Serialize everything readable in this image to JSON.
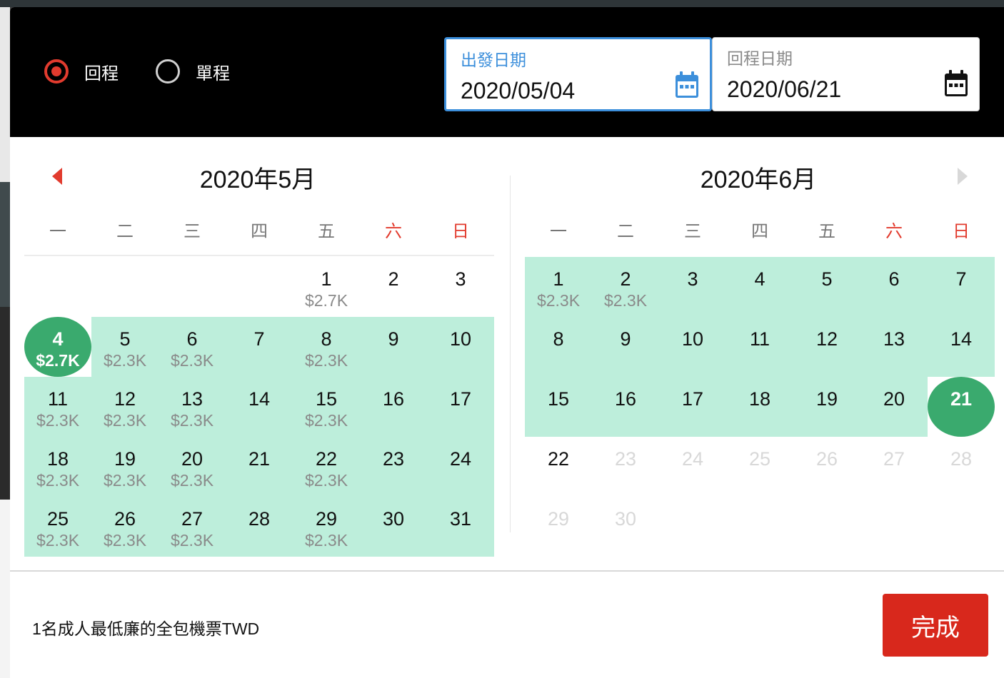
{
  "trip_type": {
    "options": [
      {
        "label": "回程",
        "checked": true
      },
      {
        "label": "單程",
        "checked": false
      }
    ]
  },
  "departure": {
    "label": "出發日期",
    "value": "2020/05/04",
    "icon": "calendar-icon",
    "icon_color": "#3c8fdb"
  },
  "return": {
    "label": "回程日期",
    "value": "2020/06/21",
    "icon": "calendar-icon",
    "icon_color": "#111111"
  },
  "weekdays": [
    "一",
    "二",
    "三",
    "四",
    "五",
    "六",
    "日"
  ],
  "colors": {
    "accent": "#e23b2e",
    "range": "#bdeedb",
    "selected": "#3aaa6e",
    "active_border": "#3c8fdb",
    "done_button": "#d8281c"
  },
  "months": [
    {
      "title": "2020年5月",
      "nav": "prev-month-arrow",
      "start_weekday_index": 4,
      "days": [
        {
          "d": "1",
          "p": "$2.7K",
          "s": "normal"
        },
        {
          "d": "2",
          "p": "",
          "s": "normal"
        },
        {
          "d": "3",
          "p": "",
          "s": "normal"
        },
        {
          "d": "4",
          "p": "$2.7K",
          "s": "selected"
        },
        {
          "d": "5",
          "p": "$2.3K",
          "s": "range"
        },
        {
          "d": "6",
          "p": "$2.3K",
          "s": "range"
        },
        {
          "d": "7",
          "p": "",
          "s": "range"
        },
        {
          "d": "8",
          "p": "$2.3K",
          "s": "range"
        },
        {
          "d": "9",
          "p": "",
          "s": "range"
        },
        {
          "d": "10",
          "p": "",
          "s": "range"
        },
        {
          "d": "11",
          "p": "$2.3K",
          "s": "range"
        },
        {
          "d": "12",
          "p": "$2.3K",
          "s": "range"
        },
        {
          "d": "13",
          "p": "$2.3K",
          "s": "range"
        },
        {
          "d": "14",
          "p": "",
          "s": "range"
        },
        {
          "d": "15",
          "p": "$2.3K",
          "s": "range"
        },
        {
          "d": "16",
          "p": "",
          "s": "range"
        },
        {
          "d": "17",
          "p": "",
          "s": "range"
        },
        {
          "d": "18",
          "p": "$2.3K",
          "s": "range"
        },
        {
          "d": "19",
          "p": "$2.3K",
          "s": "range"
        },
        {
          "d": "20",
          "p": "$2.3K",
          "s": "range"
        },
        {
          "d": "21",
          "p": "",
          "s": "range"
        },
        {
          "d": "22",
          "p": "$2.3K",
          "s": "range"
        },
        {
          "d": "23",
          "p": "",
          "s": "range"
        },
        {
          "d": "24",
          "p": "",
          "s": "range"
        },
        {
          "d": "25",
          "p": "$2.3K",
          "s": "range"
        },
        {
          "d": "26",
          "p": "$2.3K",
          "s": "range"
        },
        {
          "d": "27",
          "p": "$2.3K",
          "s": "range"
        },
        {
          "d": "28",
          "p": "",
          "s": "range"
        },
        {
          "d": "29",
          "p": "$2.3K",
          "s": "range"
        },
        {
          "d": "30",
          "p": "",
          "s": "range"
        },
        {
          "d": "31",
          "p": "",
          "s": "range"
        }
      ]
    },
    {
      "title": "2020年6月",
      "nav": "next-month-arrow",
      "start_weekday_index": 0,
      "days": [
        {
          "d": "1",
          "p": "$2.3K",
          "s": "range"
        },
        {
          "d": "2",
          "p": "$2.3K",
          "s": "range"
        },
        {
          "d": "3",
          "p": "",
          "s": "range"
        },
        {
          "d": "4",
          "p": "",
          "s": "range"
        },
        {
          "d": "5",
          "p": "",
          "s": "range"
        },
        {
          "d": "6",
          "p": "",
          "s": "range"
        },
        {
          "d": "7",
          "p": "",
          "s": "range"
        },
        {
          "d": "8",
          "p": "",
          "s": "range"
        },
        {
          "d": "9",
          "p": "",
          "s": "range"
        },
        {
          "d": "10",
          "p": "",
          "s": "range"
        },
        {
          "d": "11",
          "p": "",
          "s": "range"
        },
        {
          "d": "12",
          "p": "",
          "s": "range"
        },
        {
          "d": "13",
          "p": "",
          "s": "range"
        },
        {
          "d": "14",
          "p": "",
          "s": "range"
        },
        {
          "d": "15",
          "p": "",
          "s": "range"
        },
        {
          "d": "16",
          "p": "",
          "s": "range"
        },
        {
          "d": "17",
          "p": "",
          "s": "range"
        },
        {
          "d": "18",
          "p": "",
          "s": "range"
        },
        {
          "d": "19",
          "p": "",
          "s": "range"
        },
        {
          "d": "20",
          "p": "",
          "s": "range"
        },
        {
          "d": "21",
          "p": "",
          "s": "selected"
        },
        {
          "d": "22",
          "p": "",
          "s": "normal"
        },
        {
          "d": "23",
          "p": "",
          "s": "disabled"
        },
        {
          "d": "24",
          "p": "",
          "s": "disabled"
        },
        {
          "d": "25",
          "p": "",
          "s": "disabled"
        },
        {
          "d": "26",
          "p": "",
          "s": "disabled"
        },
        {
          "d": "27",
          "p": "",
          "s": "disabled"
        },
        {
          "d": "28",
          "p": "",
          "s": "disabled"
        },
        {
          "d": "29",
          "p": "",
          "s": "disabled"
        },
        {
          "d": "30",
          "p": "",
          "s": "disabled"
        }
      ]
    }
  ],
  "footer": {
    "note": "1名成人最低廉的全包機票TWD",
    "done_label": "完成"
  }
}
